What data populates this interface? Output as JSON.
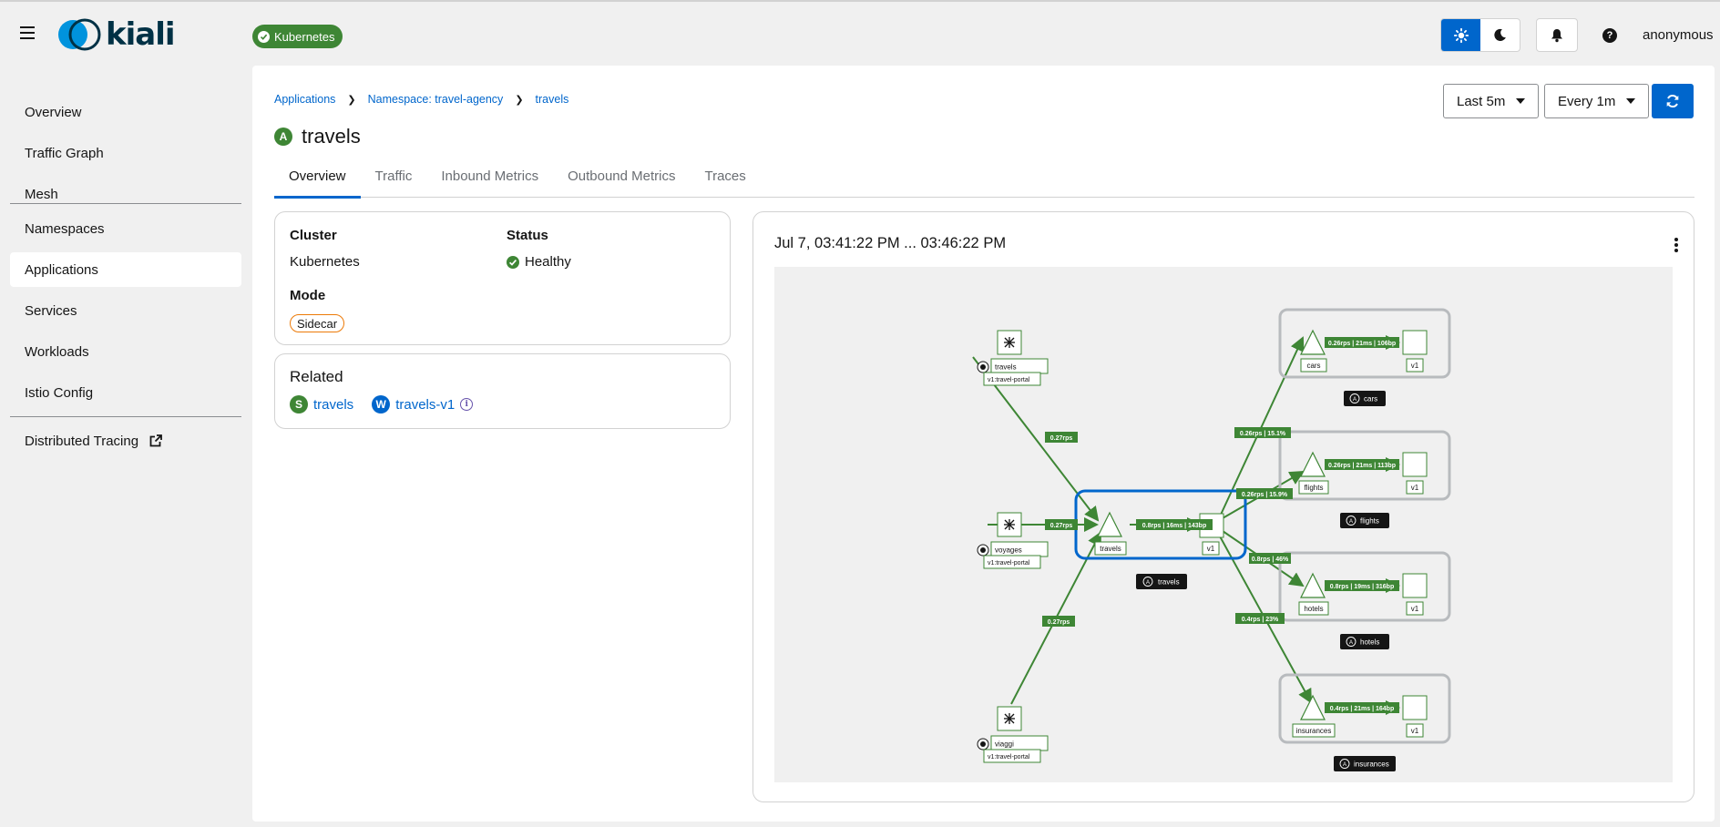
{
  "masthead": {
    "logo_text": "kiali",
    "cluster_badge": "Kubernetes",
    "user": "anonymous",
    "icons": [
      "menu-icon",
      "check-circle-icon",
      "sun-icon",
      "moon-icon",
      "bell-icon",
      "help-icon"
    ],
    "accent_color": "#0066cc"
  },
  "sidebar": {
    "items": [
      {
        "label": "Overview"
      },
      {
        "label": "Traffic Graph"
      },
      {
        "label": "Mesh"
      },
      {
        "label": "Namespaces"
      },
      {
        "label": "Applications",
        "active": true
      },
      {
        "label": "Services"
      },
      {
        "label": "Workloads"
      },
      {
        "label": "Istio Config"
      },
      {
        "label": "Distributed Tracing",
        "icon": "external-link-icon"
      }
    ]
  },
  "breadcrumb": [
    "Applications",
    "Namespace: travel-agency",
    "travels"
  ],
  "page": {
    "badge": "A",
    "title": "travels",
    "time_range": "Last 5m",
    "refresh_interval": "Every 1m"
  },
  "tabs": [
    "Overview",
    "Traffic",
    "Inbound Metrics",
    "Outbound Metrics",
    "Traces"
  ],
  "info_card": {
    "cluster_label": "Cluster",
    "cluster_value": "Kubernetes",
    "status_label": "Status",
    "status_value": "Healthy",
    "mode_label": "Mode",
    "mode_value": "Sidecar"
  },
  "related": {
    "title": "Related",
    "service_badge": "S",
    "service": "travels",
    "workload_badge": "W",
    "workload": "travels-v1"
  },
  "graph": {
    "time_range": "Jul 7, 03:41:22 PM ... 03:46:22 PM",
    "sources": [
      {
        "name": "travels",
        "version": "v1:travel-portal"
      },
      {
        "name": "voyages",
        "version": "v1:travel-portal"
      },
      {
        "name": "viaggi",
        "version": "v1:travel-portal"
      }
    ],
    "center": {
      "name": "travels",
      "version": "v1",
      "app_label": "travels",
      "edge_label": "0.8rps | 16ms | 143bp"
    },
    "source_edges": [
      "0.27rps",
      "0.27rps",
      "0.27rps"
    ],
    "targets": [
      {
        "name": "cars",
        "version": "v1",
        "app_label": "cars",
        "node_edge": "0.26rps | 21ms | 106bp",
        "edge": "0.26rps | 15.1%"
      },
      {
        "name": "flights",
        "version": "v1",
        "app_label": "flights",
        "node_edge": "0.26rps | 21ms | 113bp",
        "edge": "0.26rps | 15.9%"
      },
      {
        "name": "hotels",
        "version": "v1",
        "app_label": "hotels",
        "node_edge": "0.8rps | 19ms | 316bp",
        "edge": "0.8rps | 46%"
      },
      {
        "name": "insurances",
        "version": "v1",
        "app_label": "insurances",
        "node_edge": "0.4rps | 21ms | 164bp",
        "edge": "0.4rps | 23%"
      }
    ],
    "app_badge": "A",
    "edge_color": "#3e8635"
  }
}
